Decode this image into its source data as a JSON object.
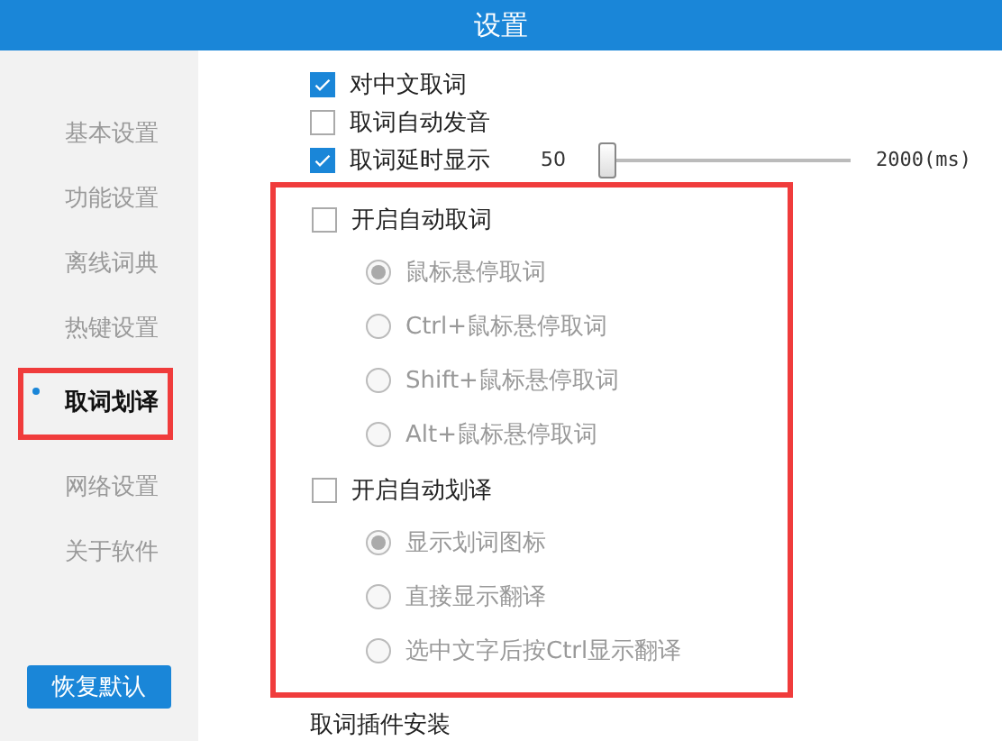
{
  "window": {
    "title": "设置"
  },
  "sidebar": {
    "items": [
      {
        "label": "基本设置",
        "selected": false,
        "highlighted": false
      },
      {
        "label": "功能设置",
        "selected": false,
        "highlighted": false
      },
      {
        "label": "离线词典",
        "selected": false,
        "highlighted": false
      },
      {
        "label": "热键设置",
        "selected": false,
        "highlighted": false
      },
      {
        "label": "取词划译",
        "selected": true,
        "highlighted": true
      },
      {
        "label": "网络设置",
        "selected": false,
        "highlighted": false
      },
      {
        "label": "关于软件",
        "selected": false,
        "highlighted": false
      }
    ],
    "reset_button": "恢复默认"
  },
  "options": [
    {
      "label": "对中文取词",
      "checked": true
    },
    {
      "label": "取词自动发音",
      "checked": false
    },
    {
      "label": "取词延时显示",
      "checked": true
    }
  ],
  "delay_slider": {
    "min_label": "50",
    "max_label": "2000(ms)",
    "level": 0
  },
  "highlight_box": true,
  "groups": [
    {
      "label": "开启自动取词",
      "checked": false,
      "modes": [
        {
          "label": "鼠标悬停取词",
          "selected": true,
          "disabled": true
        },
        {
          "label": "Ctrl+鼠标悬停取词",
          "selected": false,
          "disabled": true
        },
        {
          "label": "Shift+鼠标悬停取词",
          "selected": false,
          "disabled": true
        },
        {
          "label": "Alt+鼠标悬停取词",
          "selected": false,
          "disabled": true
        }
      ]
    },
    {
      "label": "开启自动划译",
      "checked": false,
      "modes": [
        {
          "label": "显示划词图标",
          "selected": true,
          "disabled": true
        },
        {
          "label": "直接显示翻译",
          "selected": false,
          "disabled": true
        },
        {
          "label": "选中文字后按Ctrl显示翻译",
          "selected": false,
          "disabled": true
        }
      ]
    }
  ],
  "footer_link": "取词插件安装"
}
